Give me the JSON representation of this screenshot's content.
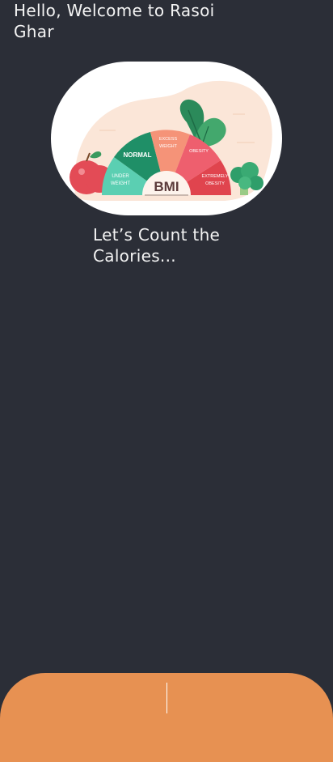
{
  "header": {
    "greeting": "Hello, Welcome to Rasoi Ghar"
  },
  "hero": {
    "image_name": "bmi-meter-illustration",
    "center_label": "BMI",
    "segments": [
      "UNDER WEIGHT",
      "NORMAL",
      "EXCESS WEIGHT",
      "OBESITY",
      "EXTREMELY OBESITY"
    ]
  },
  "subtitle": "Let’s Count the Calories...",
  "colors": {
    "background": "#2b2e37",
    "bottom_bar": "#e79152",
    "text": "#f4f4f4"
  }
}
